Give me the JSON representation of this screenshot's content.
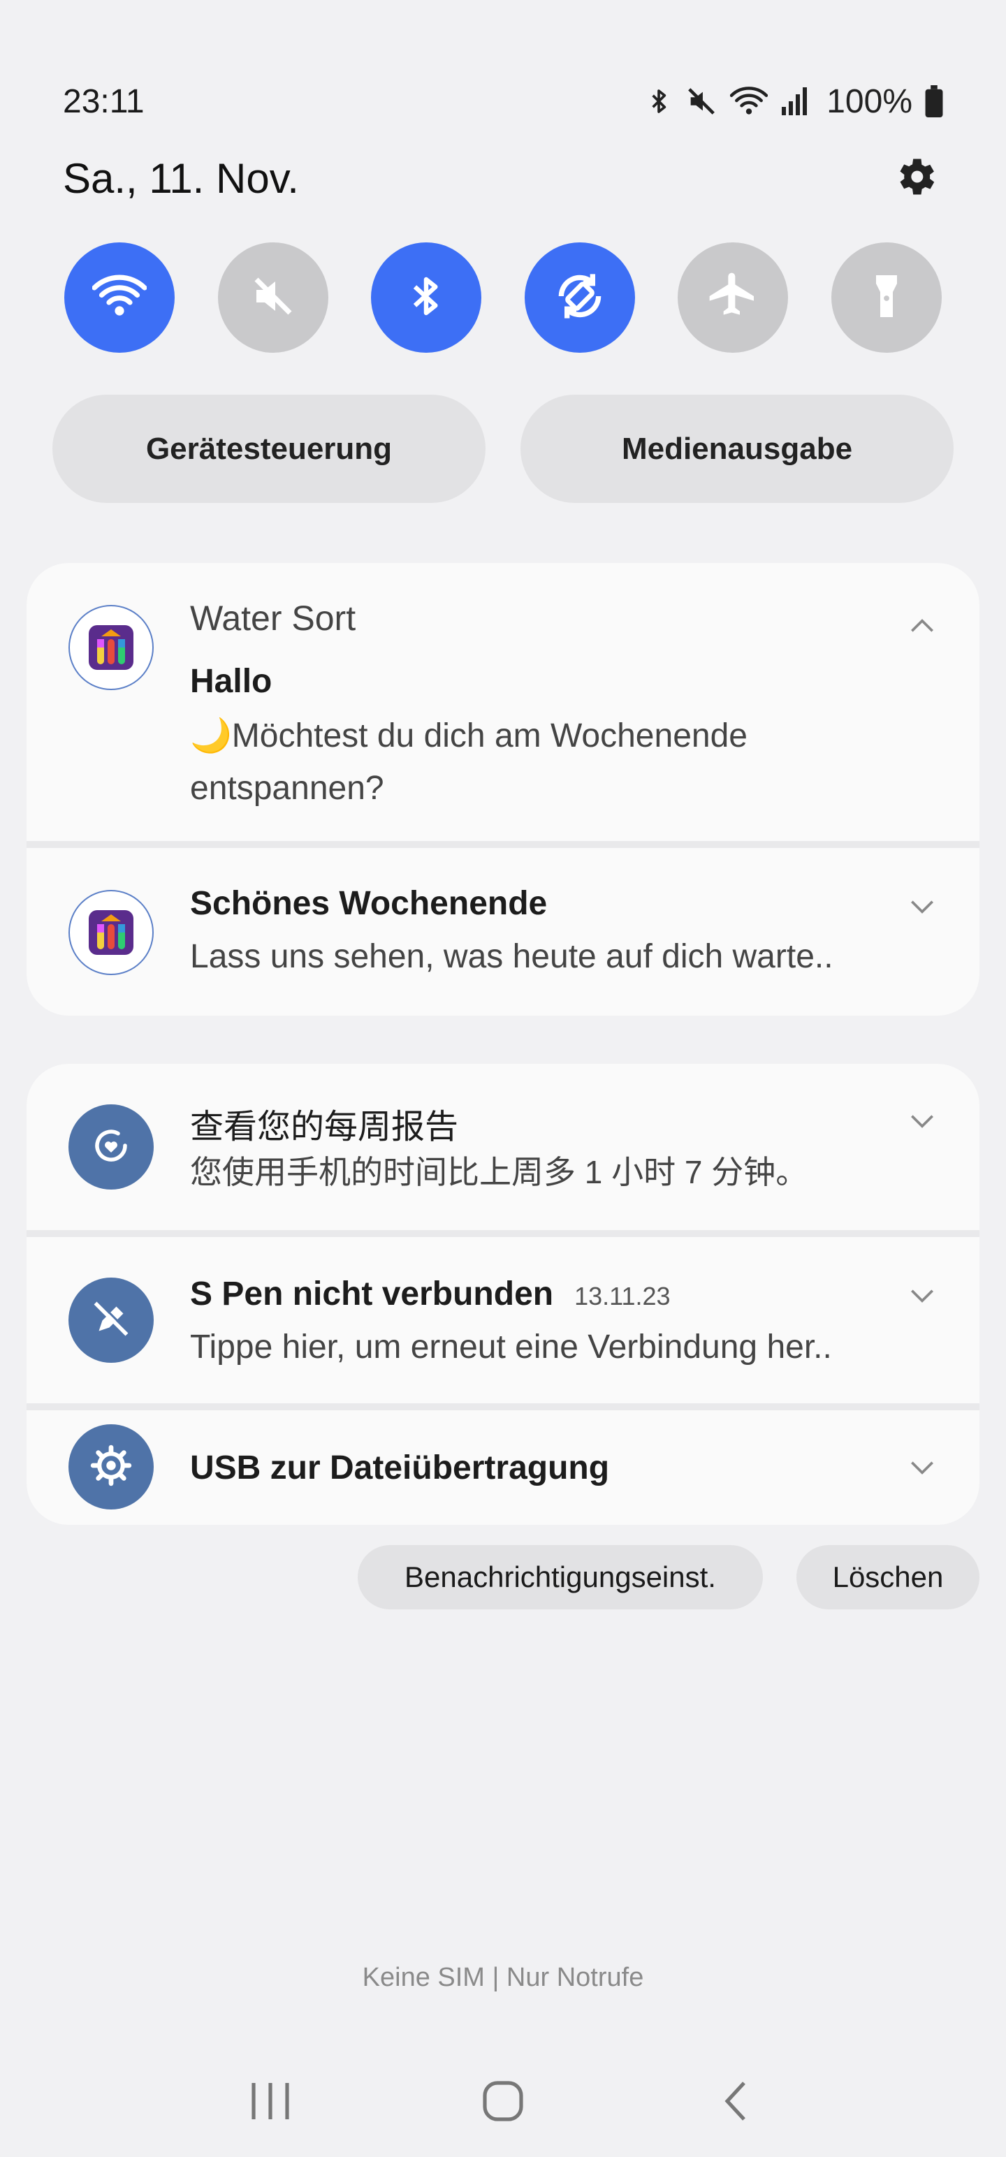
{
  "status_bar": {
    "time": "23:11",
    "battery": "100%",
    "icons": [
      "bluetooth-icon",
      "mute-icon",
      "wifi-icon",
      "signal-icon",
      "battery-icon"
    ]
  },
  "header": {
    "date": "Sa., 11. Nov."
  },
  "quick_toggles": [
    {
      "name": "wifi",
      "state": "on"
    },
    {
      "name": "sound",
      "state": "off"
    },
    {
      "name": "bluetooth",
      "state": "on"
    },
    {
      "name": "auto-rotate",
      "state": "on"
    },
    {
      "name": "airplane-mode",
      "state": "off"
    },
    {
      "name": "flashlight",
      "state": "off"
    }
  ],
  "pills": {
    "device_control": "Gerätesteuerung",
    "media_output": "Medienausgabe"
  },
  "notifications": {
    "water_sort": {
      "app": "Water Sort",
      "msg1": {
        "title": "Hallo",
        "text1": "🌙Möchtest du dich am Wochenende",
        "text2": "entspannen?"
      },
      "msg2": {
        "title": "Schönes Wochenende",
        "text": "Lass uns sehen, was heute auf dich warte.."
      }
    },
    "weekly_report": {
      "title": "查看您的每周报告",
      "text": "您使用手机的时间比上周多 1 小时 7 分钟。"
    },
    "spen": {
      "title": "S Pen nicht verbunden",
      "date": "13.11.23",
      "text": "Tippe hier, um erneut eine Verbindung her.."
    },
    "usb": {
      "title": "USB zur Dateiübertragung"
    }
  },
  "actions": {
    "settings": "Benachrichtigungseinst.",
    "clear": "Löschen"
  },
  "footer": {
    "sim": "Keine SIM | Nur Notrufe"
  },
  "colors": {
    "accent": "#3d6ff5",
    "toggle_off": "#c9c9cb",
    "system_icon": "#4f73a8",
    "background": "#f1f1f3"
  }
}
